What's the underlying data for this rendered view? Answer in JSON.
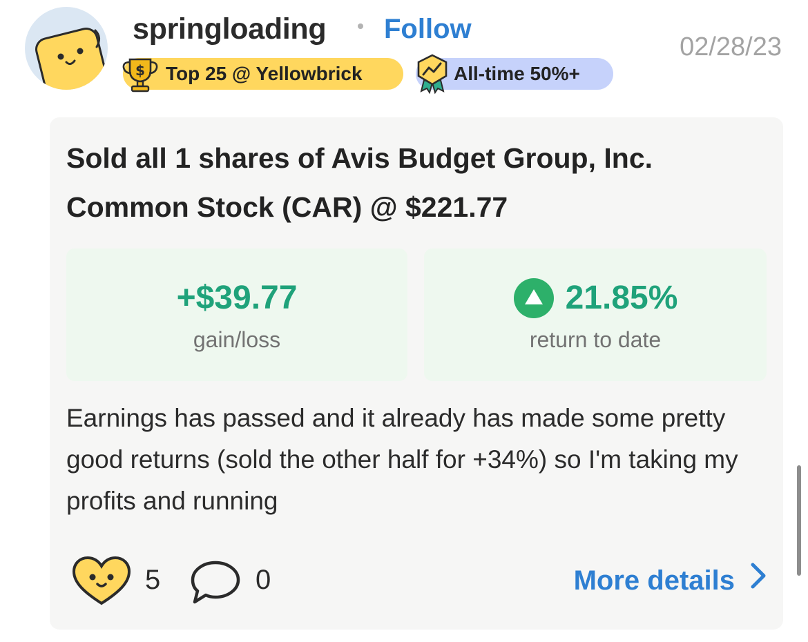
{
  "post": {
    "username": "springloading",
    "follow_label": "Follow",
    "date": "02/28/23",
    "badges": [
      {
        "label": "Top 25 @ Yellowbrick",
        "icon": "trophy-dollar-icon",
        "color": "#ffd75e"
      },
      {
        "label": "All-time 50%+",
        "icon": "chart-ribbon-icon",
        "color": "#c6d2fb"
      }
    ],
    "title": "Sold all 1 shares of Avis Budget Group, Inc. Common Stock (CAR) @ $221.77",
    "stats": {
      "gain_value": "+$39.77",
      "gain_label": "gain/loss",
      "return_value": "21.85%",
      "return_label": "return to date",
      "return_icon": "up-triangle-icon"
    },
    "body": "Earnings has passed and it already has made some pretty good returns (sold the other half for +34%) so I'm taking my profits and running",
    "likes": "5",
    "comments": "0",
    "more_details_label": "More details"
  },
  "colors": {
    "accent": "#2e7fd2",
    "gain": "#1fa27a",
    "badge_yellow": "#ffd75e",
    "badge_blue": "#c6d2fb",
    "card_bg": "#f6f6f5",
    "stat_bg": "#eef8ef"
  }
}
